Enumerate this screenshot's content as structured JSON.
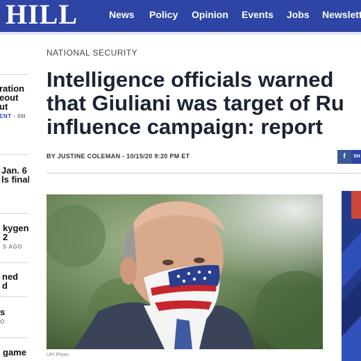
{
  "header": {
    "logo": "HILL",
    "nav": [
      "News",
      "Policy",
      "Opinion",
      "Events",
      "Jobs",
      "Newsletters"
    ],
    "brand_color": "#2e45a6"
  },
  "rail": {
    "items": [
      {
        "lines": [
          "ration",
          "eout",
          "ut"
        ],
        "meta_highlight": "ENT",
        "meta_rest": " - 8M"
      },
      {
        "lines": [
          "Jan. 6",
          "ls final"
        ],
        "meta_highlight": "",
        "meta_rest": ""
      },
      {
        "lines": [
          "kygen",
          "2"
        ],
        "meta_highlight": "",
        "meta_rest": "S AGO"
      },
      {
        "lines": [
          "ned",
          "d"
        ],
        "meta_highlight": "",
        "meta_rest": ""
      },
      {
        "lines": [
          "s"
        ],
        "meta_highlight": "",
        "meta_rest": "O"
      },
      {
        "lines": [
          "game"
        ],
        "meta_highlight": "",
        "meta_rest": ""
      }
    ]
  },
  "article": {
    "section": "NATIONAL SECURITY",
    "headline_lines": [
      "Intelligence officials warned",
      "that Giuliani was target of Ru",
      "influence campaign: report"
    ],
    "byline": "BY JUSTINE COLEMAN - 10/15/20 9:20 PM ET",
    "share_facebook": "f",
    "share_label": "SH",
    "photo_credit": "UPI Photo"
  },
  "colors": {
    "headline": "#1c2434",
    "facebook": "#3b5998"
  }
}
